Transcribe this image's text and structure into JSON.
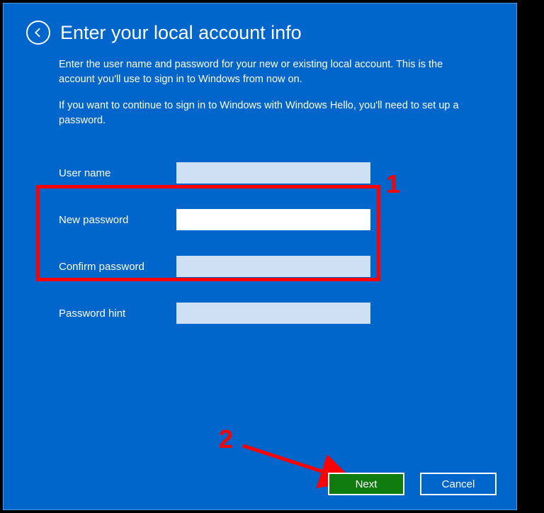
{
  "header": {
    "title": "Enter your local account info"
  },
  "description": {
    "para1": "Enter the user name and password for your new or existing local account. This is the account you'll use to sign in to Windows from now on.",
    "para2": "If you want to continue to sign in to Windows with Windows Hello, you'll need to set up a password."
  },
  "form": {
    "username_label": "User name",
    "username_value": "",
    "newpassword_label": "New password",
    "newpassword_value": "",
    "confirmpassword_label": "Confirm password",
    "confirmpassword_value": "",
    "passwordhint_label": "Password hint",
    "passwordhint_value": ""
  },
  "buttons": {
    "next": "Next",
    "cancel": "Cancel"
  },
  "annotations": {
    "step1": "1",
    "step2": "2"
  },
  "colors": {
    "background": "#0066CC",
    "highlight": "#ff0000",
    "primary_button": "#107C10"
  }
}
